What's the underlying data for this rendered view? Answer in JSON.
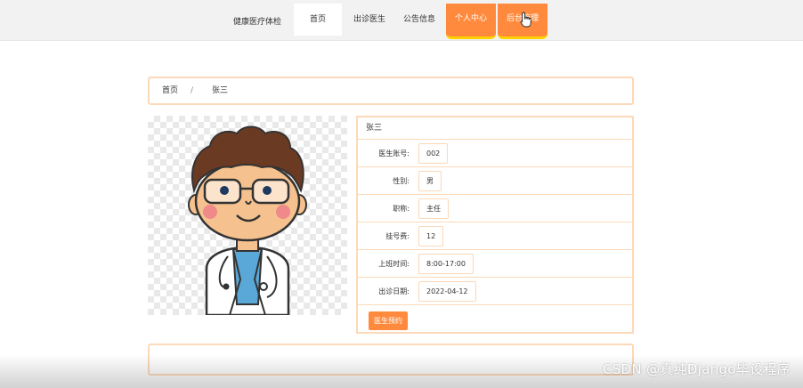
{
  "nav": {
    "brand": "健康医疗体检",
    "items": [
      {
        "label": "首页"
      },
      {
        "label": "出诊医生"
      },
      {
        "label": "公告信息"
      },
      {
        "label": "个人中心"
      },
      {
        "label": "后台管理"
      }
    ],
    "active_color": "#ff8a3d",
    "active_underline_color": "#ffd200"
  },
  "breadcrumb": {
    "home": "首页",
    "separator": "/",
    "current": "张三"
  },
  "doctor": {
    "name": "张三",
    "fields": [
      {
        "label": "医生账号:",
        "value": "002"
      },
      {
        "label": "性别:",
        "value": "男"
      },
      {
        "label": "职称:",
        "value": "主任"
      },
      {
        "label": "挂号费:",
        "value": "12"
      },
      {
        "label": "上班时间:",
        "value": "8:00-17:00"
      },
      {
        "label": "出诊日期:",
        "value": "2022-04-12"
      }
    ],
    "book_button": "医生预约",
    "photo_icon": "doctor-avatar-illustration"
  },
  "watermark": "CSDN @真纯Django毕设程序",
  "colors": {
    "accent": "#ff8a3d",
    "border": "#fcd9b8"
  }
}
